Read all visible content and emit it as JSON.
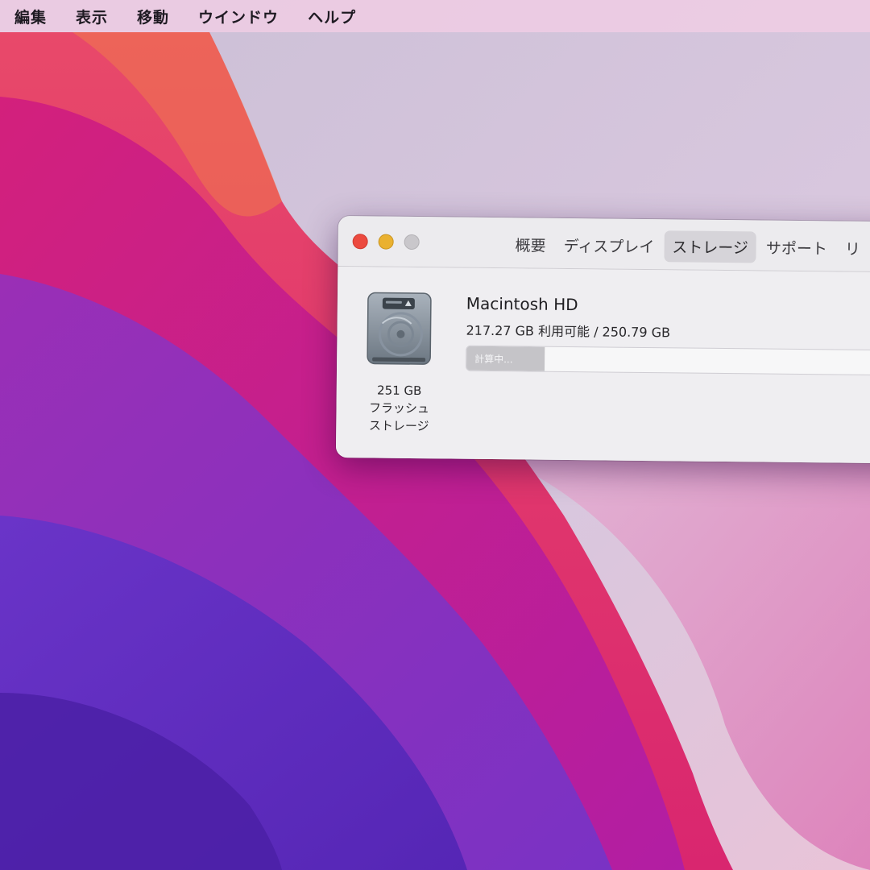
{
  "menubar": {
    "items": [
      {
        "label": "編集"
      },
      {
        "label": "表示"
      },
      {
        "label": "移動"
      },
      {
        "label": "ウインドウ"
      },
      {
        "label": "ヘルプ"
      }
    ]
  },
  "window": {
    "tabs": [
      {
        "label": "概要",
        "active": false
      },
      {
        "label": "ディスプレイ",
        "active": false
      },
      {
        "label": "ストレージ",
        "active": true
      },
      {
        "label": "サポート",
        "active": false
      },
      {
        "label": "リ",
        "active": false
      }
    ],
    "drive": {
      "icon": "internal-drive-icon",
      "caption_line1": "251 GB",
      "caption_line2": "フラッシュ",
      "caption_line3": "ストレージ"
    },
    "volume": {
      "name": "Macintosh HD",
      "space": "217.27 GB 利用可能 / 250.79 GB",
      "status": "計算中...",
      "bar_fill_fraction": 0.18
    }
  },
  "colors": {
    "close": "#ec4a3f",
    "minimize": "#eab130",
    "zoom": "#c9c7cb",
    "wallpaper_accent": "#e0245e"
  }
}
